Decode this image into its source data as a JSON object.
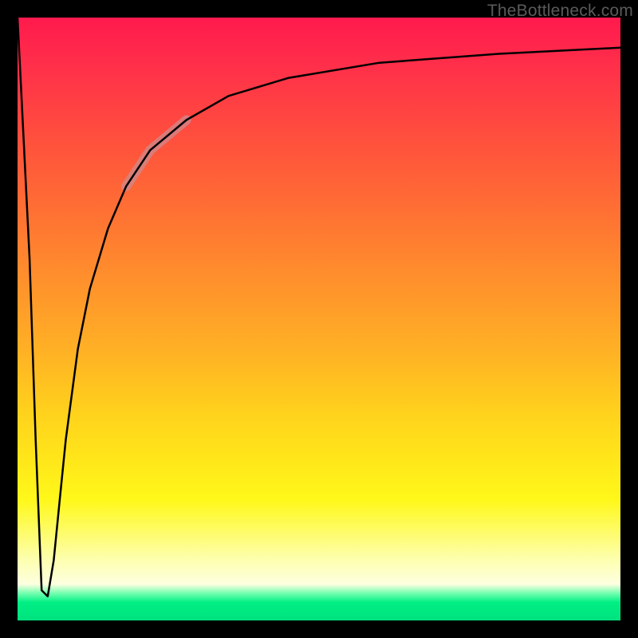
{
  "watermark": "TheBottleneck.com",
  "chart_data": {
    "type": "line",
    "title": "",
    "xlabel": "",
    "ylabel": "",
    "xlim": [
      0,
      100
    ],
    "ylim": [
      0,
      100
    ],
    "series": [
      {
        "name": "curve",
        "x": [
          0,
          2,
          3,
          4,
          5,
          6,
          7,
          8,
          10,
          12,
          15,
          18,
          22,
          28,
          35,
          45,
          60,
          80,
          100
        ],
        "y": [
          100,
          60,
          30,
          5,
          4,
          10,
          20,
          30,
          45,
          55,
          65,
          72,
          78,
          83,
          87,
          90,
          92.5,
          94,
          95
        ]
      }
    ],
    "highlight_segment": {
      "x_start": 18,
      "x_end": 28
    },
    "gradient_stops": [
      {
        "pos": 0,
        "color": "#ff1a4d"
      },
      {
        "pos": 42,
        "color": "#ff8c2d"
      },
      {
        "pos": 74,
        "color": "#ffe81a"
      },
      {
        "pos": 95,
        "color": "#72ffb0"
      },
      {
        "pos": 100,
        "color": "#00e27f"
      }
    ]
  }
}
